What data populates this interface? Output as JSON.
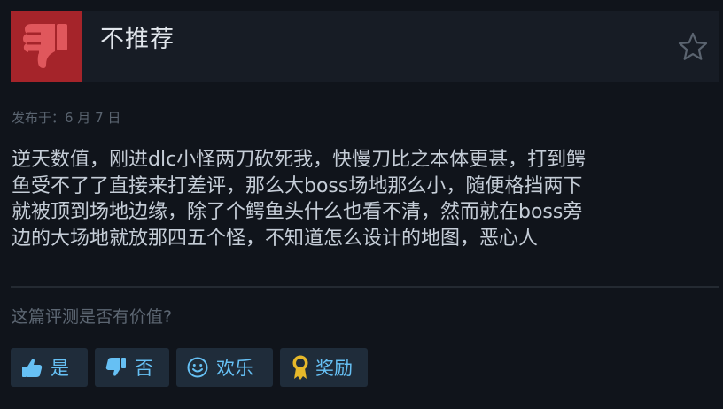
{
  "review": {
    "verdict": "不推荐",
    "posted": "发布于：6 月 7 日",
    "body": "逆天数值，刚进dlc小怪两刀砍死我，快慢刀比之本体更甚，打到鳄\n鱼受不了了直接来打差评，那么大boss场地那么小，随便格挡两下\n就被顶到场地边缘，除了个鳄鱼头什么也看不清，然而就在boss旁\n边的大场地就放那四五个怪，不知道怎么设计的地图，恶心人"
  },
  "feedback": {
    "question": "这篇评测是否有价值?",
    "buttons": {
      "yes": "是",
      "no": "否",
      "funny": "欢乐",
      "award": "奖励"
    }
  },
  "colors": {
    "thumb_bg": "#a5242a",
    "accent": "#66c0f4",
    "award": "#e6b82a",
    "page_bg": "#10141b"
  },
  "icons": {
    "verdict": "thumbs-down-icon",
    "favorite": "star-icon",
    "yes": "thumbs-up-icon",
    "no": "thumbs-down-icon",
    "funny": "smiley-icon",
    "award": "award-ribbon-icon"
  }
}
